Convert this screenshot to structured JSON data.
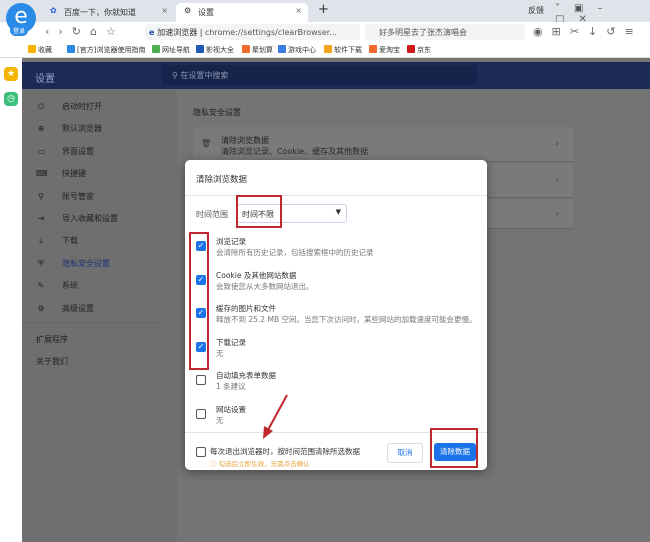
{
  "browser": {
    "tabs": [
      {
        "label": "百度一下，你就知道",
        "active": false
      },
      {
        "label": "设置",
        "active": true
      }
    ],
    "new_tab": "+",
    "window_controls": {
      "feedback": "反馈"
    },
    "login_badge": "登录",
    "address": {
      "site_name": "加速浏览器",
      "url": "chrome://settings/clearBrowser..."
    },
    "search_box": "好多明星去了张杰演唱会",
    "bookmarks": [
      {
        "label": "收藏",
        "color": "#f5b400"
      },
      {
        "label": "[官方]浏览器使用指南",
        "color": "#2a8be6"
      },
      {
        "label": "网址导航",
        "color": "#4caf50"
      },
      {
        "label": "影视大全",
        "color": "#1e5bb8"
      },
      {
        "label": "聚划算",
        "color": "#f06a2a"
      },
      {
        "label": "游戏中心",
        "color": "#3c7be0"
      },
      {
        "label": "软件下载",
        "color": "#f2a31b"
      },
      {
        "label": "爱淘宝",
        "color": "#f06a2a"
      },
      {
        "label": "京东",
        "color": "#d0191c"
      }
    ]
  },
  "settings": {
    "title": "设置",
    "search_placeholder": "在设置中搜索",
    "sidebar": [
      {
        "label": "启动时打开",
        "icon": "power-icon"
      },
      {
        "label": "默认浏览器",
        "icon": "globe-icon"
      },
      {
        "label": "界面设置",
        "icon": "window-icon"
      },
      {
        "label": "快捷键",
        "icon": "keyboard-icon"
      },
      {
        "label": "账号管家",
        "icon": "key-icon"
      },
      {
        "label": "导入收藏和设置",
        "icon": "import-icon"
      },
      {
        "label": "下载",
        "icon": "download-icon"
      },
      {
        "label": "隐私安全设置",
        "icon": "shield-icon",
        "active": true
      },
      {
        "label": "系统",
        "icon": "wrench-icon"
      },
      {
        "label": "高级设置",
        "icon": "gear-icon"
      }
    ],
    "extensions": "扩展程序",
    "about": "关于我们",
    "section_title": "隐私安全设置",
    "card": {
      "title": "清除浏览数据",
      "subtitle": "清除浏览记录、Cookie、缓存及其他数据"
    }
  },
  "dialog": {
    "title": "清除浏览数据",
    "time_range_label": "时间范围",
    "time_range_value": "时间不限",
    "items": [
      {
        "title": "浏览记录",
        "desc": "会清除所有历史记录，包括搜索框中的历史记录",
        "checked": true
      },
      {
        "title": "Cookie 及其他网站数据",
        "desc": "会致使您从大多数网站退出。",
        "checked": true
      },
      {
        "title": "缓存的图片和文件",
        "desc": "释放不到 25.2 MB 空间。当您下次访问时，某些网站的加载速度可能会更慢。",
        "checked": true
      },
      {
        "title": "下载记录",
        "desc": "无",
        "checked": true
      },
      {
        "title": "自动填充表单数据",
        "desc": "1 条建议",
        "checked": false
      },
      {
        "title": "网站设置",
        "desc": "无",
        "checked": false
      }
    ],
    "footer_checkbox": {
      "label": "每次退出浏览器时，按时间范围清除所选数据",
      "note": "ⓘ 勾选后立即生效，无需点击确认",
      "checked": false
    },
    "cancel": "取消",
    "confirm": "清除数据",
    "accent": "#1a73e8",
    "annotation_color": "#c0272d"
  }
}
